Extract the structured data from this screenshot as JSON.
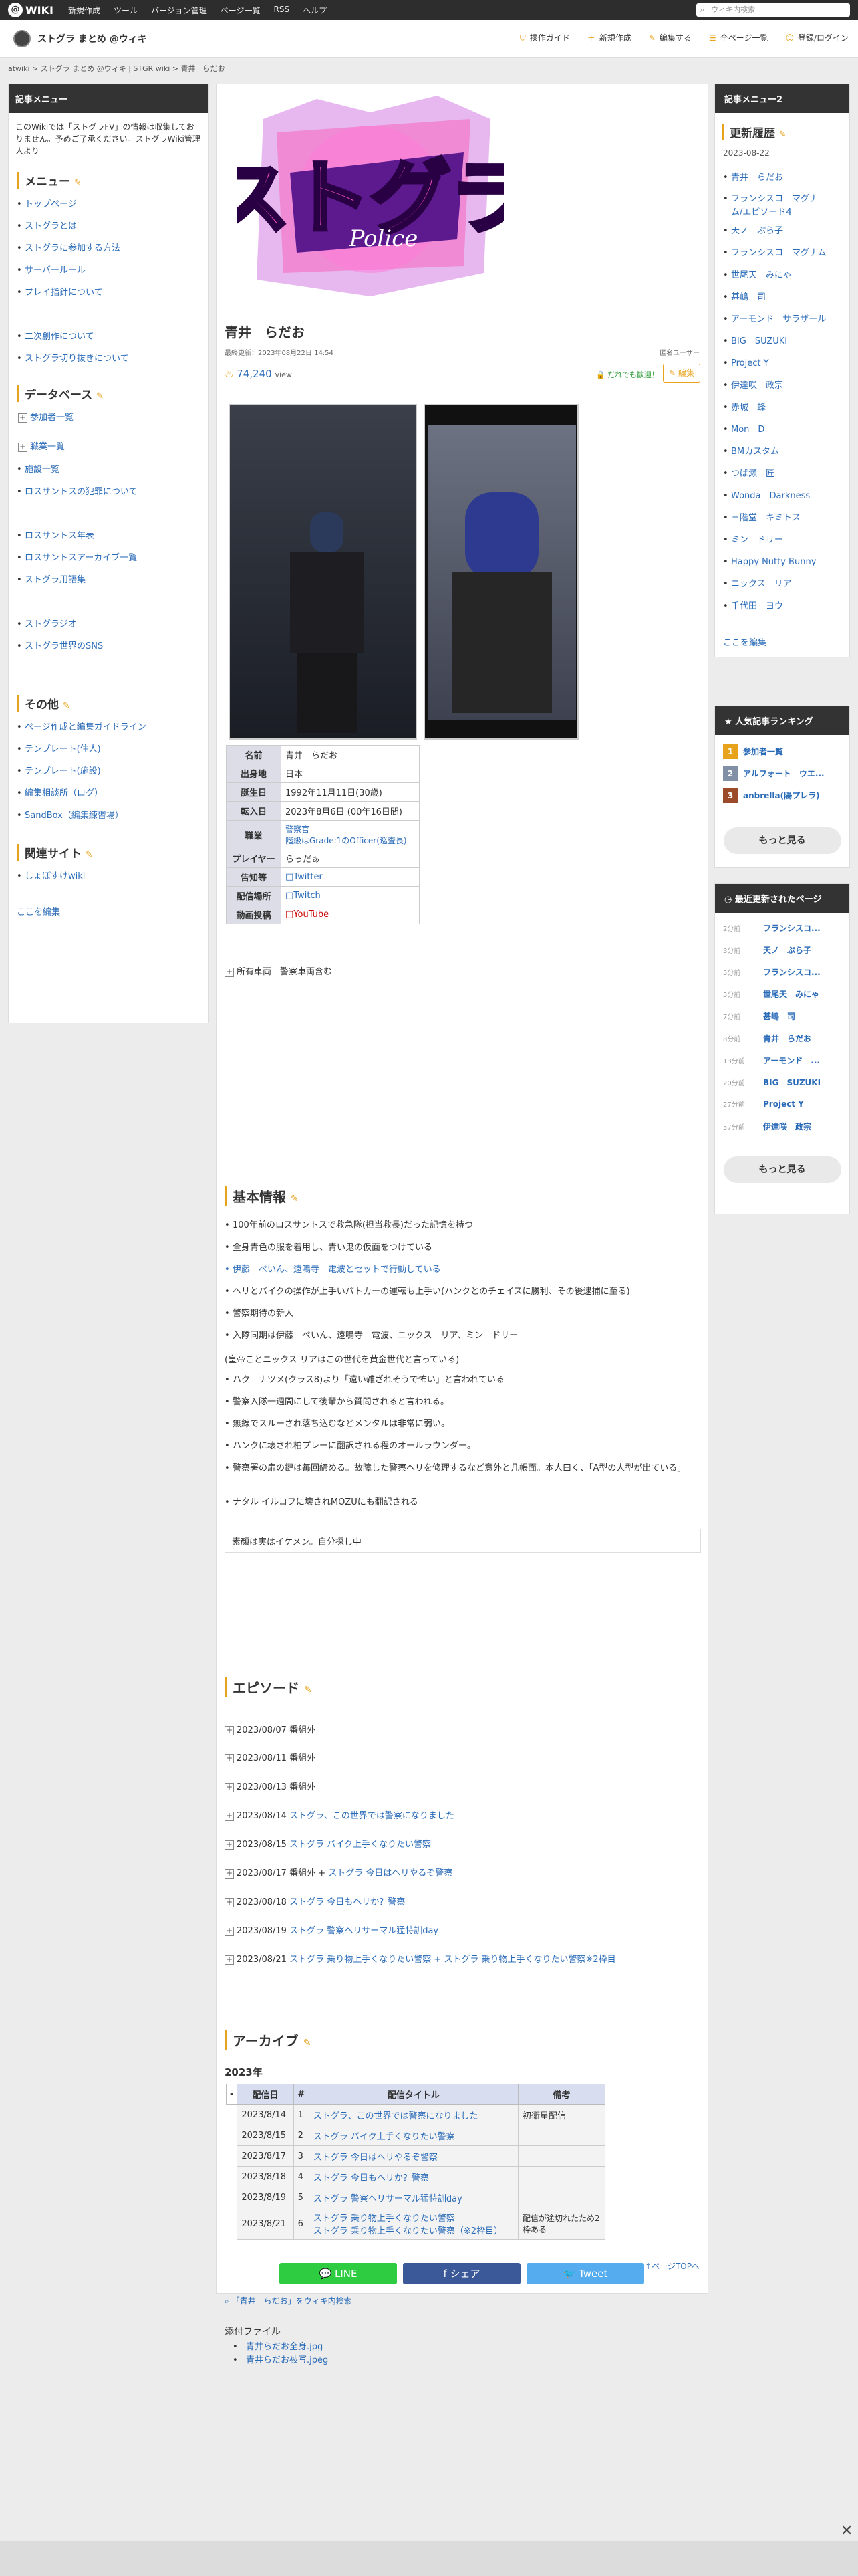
{
  "topbar": {
    "logo": "WIKI",
    "menu": [
      "新規作成",
      "ツール",
      "バージョン管理",
      "ページ一覧",
      "RSS",
      "ヘルプ"
    ],
    "search_placeholder": "ウィキ内検索"
  },
  "site": {
    "name": "ストグラ まとめ @ウィキ",
    "tools": [
      "操作ガイド",
      "新規作成",
      "編集する",
      "全ページ一覧",
      "登録/ログイン"
    ]
  },
  "breadcrumb": "atwiki > ストグラ まとめ @ウィキ | STGR wiki > 青井　らだお",
  "left": {
    "header": "記事メニュー",
    "intro": "このWikiでは「ストグラFV」の情報は収集しておりません。予めご了承ください。ストグラWiki管理人より",
    "menu_title": "メニュー",
    "menu": [
      "トップページ",
      "ストグラとは",
      "ストグラに参加する方法",
      "サーバールール",
      "プレイ指針について",
      "二次創作について",
      "ストグラ切り抜きについて"
    ],
    "db_title": "データベース",
    "db": [
      "参加者一覧",
      "職業一覧",
      "施設一覧",
      "ロスサントスの犯罪について",
      "ロスサントス年表",
      "ロスサントスアーカイブ一覧",
      "ストグラ用語集",
      "ストグラジオ",
      "ストグラ世界のSNS"
    ],
    "other_title": "その他",
    "other": [
      "ページ作成と編集ガイドライン",
      "テンプレート(住人)",
      "テンプレート(施設)",
      "編集相談所（ログ）",
      "SandBox（編集練習場）"
    ],
    "related_title": "関連サイト",
    "related": [
      "しょぼすけwiki"
    ],
    "edit": "ここを編集"
  },
  "article": {
    "title": "青井　らだお",
    "updated": "最終更新：2023年08月22日 14:54",
    "author": "匿名ユーザー",
    "views": "74,240",
    "views_unit": "view",
    "anyone_edit": "だれでも歓迎！",
    "edit": "編集",
    "profile": [
      [
        "名前",
        "青井　らだお"
      ],
      [
        "出身地",
        "日本"
      ],
      [
        "誕生日",
        "1992年11月11日(30歳)"
      ],
      [
        "転入日",
        "2023年8月6日 (00年16日間)"
      ],
      [
        "職業",
        "警察官\n階級はGrade:1のOfficer(巡査長)"
      ],
      [
        "プレイヤー",
        "らっだぁ"
      ],
      [
        "告知等",
        "□Twitter"
      ],
      [
        "配信場所",
        "□Twitch"
      ],
      [
        "動画投稿",
        "□YouTube"
      ]
    ],
    "owned_vehicles": "所有車両　警察車両含む",
    "basic_title": "基本情報",
    "basic": [
      "100年前のロスサントスで救急隊(担当救長)だった記憶を持つ",
      "全身青色の服を着用し、青い鬼の仮面をつけている",
      "伊藤　ぺいん、遠鳴寺　電波とセットで行動している",
      "ヘリとバイクの操作が上手いパトカーの運転も上手い(ハンクとのチェイスに勝利、その後逮捕に至る)",
      "警察期待の新人",
      "入隊同期は伊藤　ぺいん、遠鳴寺　電波、ニックス　リア、ミン　ドリー",
      "(皇帝ことニックス リアはこの世代を黄金世代と言っている)",
      "ハク　ナツメ(クラス8)より「遠い雑ざれそうで怖い」と言われている",
      "警察入隊一週間にして後輩から質問されると言われる。",
      "無線でスルーされ落ち込むなどメンタルは非常に弱い。",
      "ハンクに壊され柏プレーに翻訳される程のオールラウンダー。",
      "警察署の扉の鍵は毎回締める。故障した警察ヘリを修理するなど意外と几帳面。本人曰く、「A型の人型が出ている」",
      "ナタル イルコフに壊されMOZUにも翻訳される"
    ],
    "note": "素顔は実はイケメン。自分探し中",
    "episode_title": "エピソード",
    "episodes": [
      [
        "2023/08/07",
        "番組外",
        ""
      ],
      [
        "2023/08/11",
        "番組外",
        ""
      ],
      [
        "2023/08/13",
        "番組外",
        ""
      ],
      [
        "2023/08/14",
        "",
        "ストグラ、この世界では警察になりました"
      ],
      [
        "2023/08/15",
        "",
        "ストグラ バイク上手くなりたい警察"
      ],
      [
        "2023/08/17",
        "番組外 + ",
        "ストグラ 今日はヘリやるぞ警察"
      ],
      [
        "2023/08/18",
        "",
        "ストグラ 今日もヘリか？警察"
      ],
      [
        "2023/08/19",
        "",
        "ストグラ 警察ヘリサーマル猛特訓day"
      ],
      [
        "2023/08/21",
        "",
        "ストグラ 乗り物上手くなりたい警察 + ストグラ 乗り物上手くなりたい警察※2枠目"
      ]
    ],
    "archive_title": "アーカイブ",
    "year": "2023年",
    "archive_headers": [
      "配信日",
      "#",
      "配信タイトル",
      "備考"
    ],
    "archive": [
      [
        "2023/8/14",
        "1",
        "ストグラ、この世界では警察になりました",
        "初衛星配信"
      ],
      [
        "2023/8/15",
        "2",
        "ストグラ バイク上手くなりたい警察",
        ""
      ],
      [
        "2023/8/17",
        "3",
        "ストグラ 今日はヘリやるぞ警察",
        ""
      ],
      [
        "2023/8/18",
        "4",
        "ストグラ 今日もヘリか？警察",
        ""
      ],
      [
        "2023/8/19",
        "5",
        "ストグラ 警察ヘリサーマル猛特訓day",
        ""
      ],
      [
        "2023/8/21",
        "6",
        "ストグラ 乗り物上手くなりたい警察\nストグラ 乗り物上手くなりたい警察（※2枠目）",
        "配信が途切れたため2枠ある"
      ]
    ],
    "page_top": "ページTOPへ",
    "search_wiki": "「青井　らだお」をウィキ内検索",
    "share": [
      "LINE",
      "シェア",
      "Tweet"
    ]
  },
  "attachments": {
    "title": "添付ファイル",
    "files": [
      "青井らだお全身.jpg",
      "青井らだお被写.jpeg"
    ]
  },
  "right": {
    "header": "記事メニュー2",
    "history_title": "更新履歴",
    "history_date": "2023-08-22",
    "history": [
      "青井　らだお",
      "フランシスコ　マグナム/エピソード4",
      "天ノ　ぷら子",
      "フランシスコ　マグナム",
      "世尾天　みにゃ",
      "甚嶋　司",
      "アーモンド　サラザール",
      "BIG　SUZUKI",
      "Project Y",
      "伊達咲　政宗",
      "赤城　蜂",
      "Mon　D",
      "BMカスタム",
      "つば瀬　匠",
      "Wonda　Darkness",
      "三階堂　キミトス",
      "ミン　ドリー",
      "Happy Nutty Bunny",
      "ニックス　リア",
      "千代田　ヨウ"
    ],
    "edit": "ここを編集",
    "ranking_title": "人気記事ランキング",
    "ranking": [
      "参加者一覧",
      "アルフォート　ウエ...",
      "anbrella(陽プレラ)"
    ],
    "more": "もっと見る",
    "recent_title": "最近更新されたページ",
    "recent": [
      [
        "2分前",
        "フランシスコ..."
      ],
      [
        "3分前",
        "天ノ　ぷら子"
      ],
      [
        "5分前",
        "フランシスコ..."
      ],
      [
        "5分前",
        "世尾天　みにゃ"
      ],
      [
        "7分前",
        "甚嶋　司"
      ],
      [
        "8分前",
        "青井　らだお"
      ],
      [
        "13分前",
        "アーモンド　..."
      ],
      [
        "20分前",
        "BIG　SUZUKI"
      ],
      [
        "27分前",
        "Project Y"
      ],
      [
        "57分前",
        "伊達咲　政宗"
      ]
    ]
  }
}
